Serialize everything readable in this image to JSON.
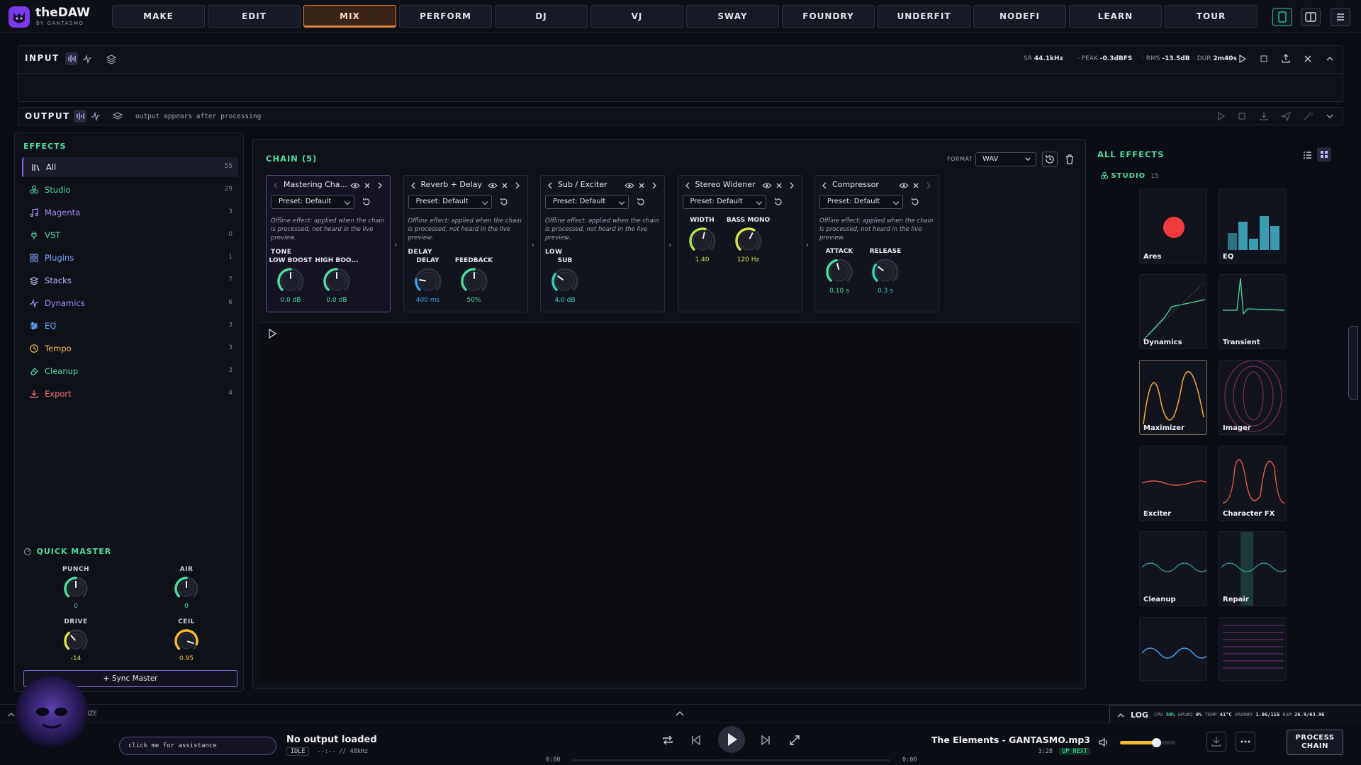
{
  "app": {
    "brand": "theDAW",
    "brand_sub": "BY GANTASMO"
  },
  "nav": {
    "tabs": [
      "MAKE",
      "EDIT",
      "MIX",
      "PERFORM",
      "DJ",
      "VJ",
      "SWAY",
      "FOUNDRY",
      "UNDERFIT",
      "NODEFI",
      "LEARN",
      "TOUR"
    ],
    "active": "MIX"
  },
  "input": {
    "label": "INPUT",
    "sr_label": "SR",
    "sr": "44.1kHz",
    "peak_label": "PEAK",
    "peak": "-0.3dBFS",
    "rms_label": "RMS",
    "rms": "-13.5dB",
    "dur_label": "DUR",
    "dur": "2m40s"
  },
  "output": {
    "label": "OUTPUT",
    "message": "output appears after processing"
  },
  "effects": {
    "title": "EFFECTS",
    "categories": [
      {
        "name": "All",
        "count": "55",
        "color": "#e6e7ec",
        "icon": "bars-icon"
      },
      {
        "name": "Studio",
        "count": "29",
        "color": "#4ade9b",
        "icon": "studio-icon"
      },
      {
        "name": "Magenta",
        "count": "3",
        "color": "#a78bfa",
        "icon": "music-note-icon"
      },
      {
        "name": "VST",
        "count": "0",
        "color": "#4ade9b",
        "icon": "plug-icon"
      },
      {
        "name": "Plugins",
        "count": "1",
        "color": "#7aa7ff",
        "icon": "plugins-icon"
      },
      {
        "name": "Stacks",
        "count": "7",
        "color": "#c4b5fd",
        "icon": "layers-icon"
      },
      {
        "name": "Dynamics",
        "count": "6",
        "color": "#a78bfa",
        "icon": "pulse-icon"
      },
      {
        "name": "EQ",
        "count": "3",
        "color": "#60a5fa",
        "icon": "sliders-icon"
      },
      {
        "name": "Tempo",
        "count": "3",
        "color": "#f2c14e",
        "icon": "clock-icon"
      },
      {
        "name": "Cleanup",
        "count": "3",
        "color": "#4ade9b",
        "icon": "eraser-icon"
      },
      {
        "name": "Export",
        "count": "4",
        "color": "#f87171",
        "icon": "download-icon"
      }
    ]
  },
  "quick_master": {
    "title": "QUICK MASTER",
    "knobs": [
      {
        "label": "PUNCH",
        "value": "0",
        "level": 0.5,
        "color": "#4ade9b"
      },
      {
        "label": "AIR",
        "value": "0",
        "level": 0.5,
        "color": "#4ade9b"
      },
      {
        "label": "DRIVE",
        "value": "-14",
        "level": 0.35,
        "color": "#d4e34a"
      },
      {
        "label": "CEIL",
        "value": "0.95",
        "level": 0.9,
        "color": "#f5b82e"
      }
    ],
    "sync_label": "Sync Master"
  },
  "chain": {
    "title": "CHAIN (5)",
    "format_label": "FORMAT",
    "format_value": "WAV",
    "note": "Offline effect: applied when the chain is processed, not heard in the live preview.",
    "cards": [
      {
        "title": "Mastering Cha...",
        "preset": "Preset: Default",
        "group": "TONE",
        "knobs": [
          {
            "label": "LOW BOOST",
            "value": "0.0 dB",
            "level": 0.5,
            "color": "#4ade9b"
          },
          {
            "label": "HIGH BOO...",
            "value": "0.0 dB",
            "level": 0.5,
            "color": "#4ade9b"
          }
        ]
      },
      {
        "title": "Reverb + Delay",
        "preset": "Preset: Default",
        "group": "DELAY",
        "knobs": [
          {
            "label": "DELAY",
            "value": "400 ms",
            "level": 0.2,
            "color": "#3b9ff0"
          },
          {
            "label": "FEEDBACK",
            "value": "50%",
            "level": 0.5,
            "color": "#4ade9b"
          }
        ]
      },
      {
        "title": "Sub / Exciter",
        "preset": "Preset: Default",
        "group": "LOW",
        "knobs": [
          {
            "label": "SUB",
            "value": "4.0 dB",
            "level": 0.3,
            "color": "#2dd4bf"
          }
        ]
      },
      {
        "title": "Stereo Widener",
        "preset": "Preset: Default",
        "group": "",
        "knobs": [
          {
            "label": "WIDTH",
            "value": "1.40",
            "level": 0.55,
            "color": "#b6e34a"
          },
          {
            "label": "BASS MONO",
            "value": "120 Hz",
            "level": 0.6,
            "color": "#d4e34a"
          }
        ]
      },
      {
        "title": "Compressor",
        "preset": "Preset: Default",
        "group": "",
        "knobs": [
          {
            "label": "ATTACK",
            "value": "0.10 s",
            "level": 0.45,
            "color": "#4ade9b"
          },
          {
            "label": "RELEASE",
            "value": "0.3 s",
            "level": 0.3,
            "color": "#2dd4bf"
          }
        ]
      }
    ]
  },
  "all_effects": {
    "title": "ALL EFFECTS",
    "group": "STUDIO",
    "group_count": "15",
    "tiles": [
      "Ares",
      "EQ",
      "Dynamics",
      "Transient",
      "Maximizer",
      "Imager",
      "Exciter",
      "Character FX",
      "Cleanup",
      "Repair",
      "",
      ""
    ]
  },
  "bottom": {
    "log_label": "LOG",
    "cpu_label": "CPU",
    "cpu": "50%",
    "gpu_label": "GPU#2",
    "gpu": "0%",
    "temp_label": "TEMP",
    "temp": "41°C",
    "vram_label": "VRAM#2",
    "vram": "1.0G/11G",
    "ram_label": "RAM",
    "ram": "26.9/63.9G",
    "size_label": "IZE",
    "assist": "click me for assistance",
    "output_title": "No output loaded",
    "output_status": "IDLE",
    "output_meta": "--:-- // 48kHz",
    "time_start": "0:00",
    "time_end": "0:00",
    "track": "The Elements - GANTASMO.mp3",
    "track_dur": "3:28",
    "up_next": "UP NEXT",
    "volume": 0.65,
    "process_label": "PROCESS CHAIN"
  }
}
